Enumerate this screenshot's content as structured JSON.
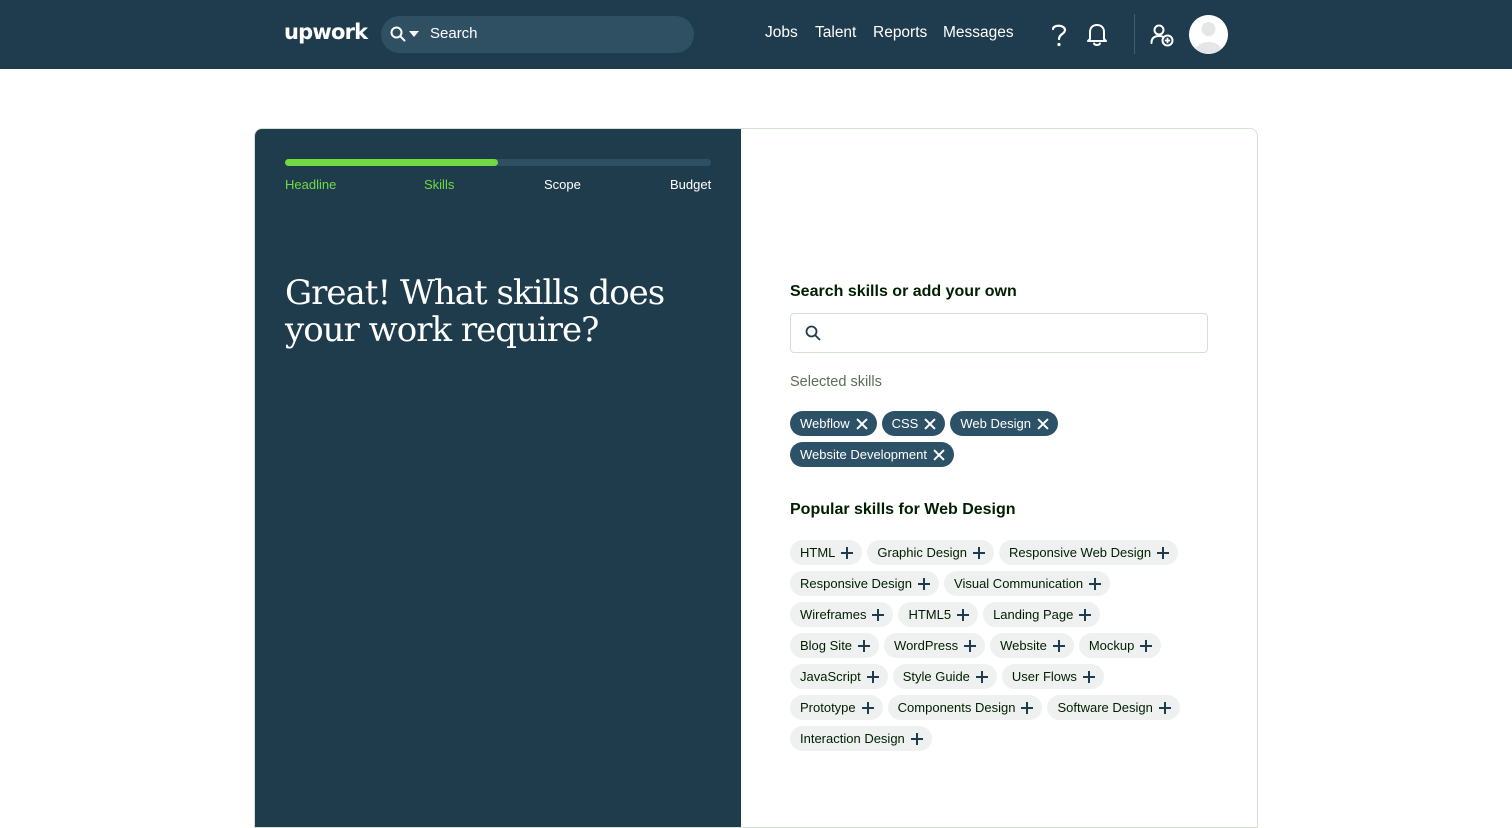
{
  "nav": {
    "logo": "upwork",
    "search_placeholder": "Search",
    "links": [
      "Jobs",
      "Talent",
      "Reports",
      "Messages"
    ]
  },
  "progress": {
    "fraction": 0.5,
    "steps": [
      {
        "label": "Headline",
        "done": true
      },
      {
        "label": "Skills",
        "done": true
      },
      {
        "label": "Scope",
        "done": false
      },
      {
        "label": "Budget",
        "done": false
      }
    ],
    "colors": {
      "done": "#6fda44",
      "panel": "#1f3c4d"
    }
  },
  "headline": "Great! What skills does your work require?",
  "skills": {
    "search_title": "Search skills or add your own",
    "search_value": "",
    "selected_label": "Selected skills",
    "selected": [
      "Webflow",
      "CSS",
      "Web Design",
      "Website Development"
    ],
    "popular_title": "Popular skills for Web Design",
    "popular": [
      "HTML",
      "Graphic Design",
      "Responsive Web Design",
      "Responsive Design",
      "Visual Communication",
      "Wireframes",
      "HTML5",
      "Landing Page",
      "Blog Site",
      "WordPress",
      "Website",
      "Mockup",
      "JavaScript",
      "Style Guide",
      "User Flows",
      "Prototype",
      "Components Design",
      "Software Design",
      "Interaction Design"
    ]
  },
  "icons": {
    "search": "search-icon",
    "help": "help-icon",
    "notifications": "bell-icon",
    "invite": "add-user-icon",
    "remove": "close-icon",
    "add": "plus-icon"
  }
}
